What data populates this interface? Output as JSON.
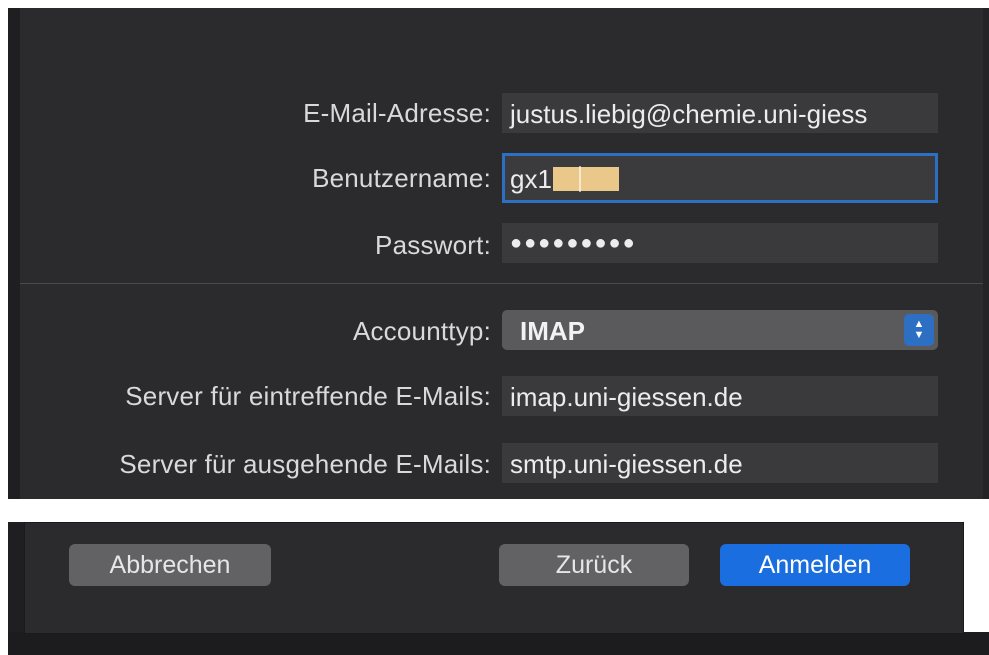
{
  "form": {
    "email": {
      "label": "E-Mail-Adresse:",
      "value": "justus.liebig@chemie.uni-giess"
    },
    "username": {
      "label": "Benutzername:",
      "value": "gx1"
    },
    "password": {
      "label": "Passwort:",
      "value": "●●●●●●●●●"
    },
    "account_type": {
      "label": "Accounttyp:",
      "value": "IMAP"
    },
    "incoming_server": {
      "label": "Server für eintreffende E-Mails:",
      "value": "imap.uni-giessen.de"
    },
    "outgoing_server": {
      "label": "Server für ausgehende E-Mails:",
      "value": "smtp.uni-giessen.de"
    }
  },
  "buttons": {
    "cancel": "Abbrechen",
    "back": "Zurück",
    "signin": "Anmelden"
  },
  "colors": {
    "accent": "#1a6ee0",
    "panel": "#2b2b2d",
    "field": "#3a3a3d"
  }
}
